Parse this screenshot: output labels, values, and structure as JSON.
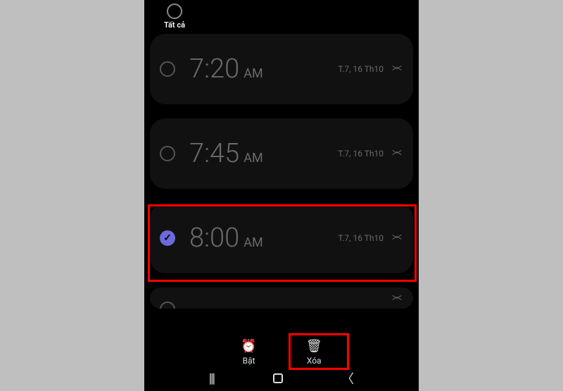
{
  "select_all": {
    "label": "Tất cả"
  },
  "alarms": [
    {
      "time": "7:20",
      "ampm": "AM",
      "date": "T.7, 16 Th10",
      "checked": false
    },
    {
      "time": "7:45",
      "ampm": "AM",
      "date": "T.7, 16 Th10",
      "checked": false
    },
    {
      "time": "8:00",
      "ampm": "AM",
      "date": "T.7, 16 Th10",
      "checked": true
    }
  ],
  "actions": {
    "enable_label": "Bật",
    "delete_label": "Xóa"
  }
}
